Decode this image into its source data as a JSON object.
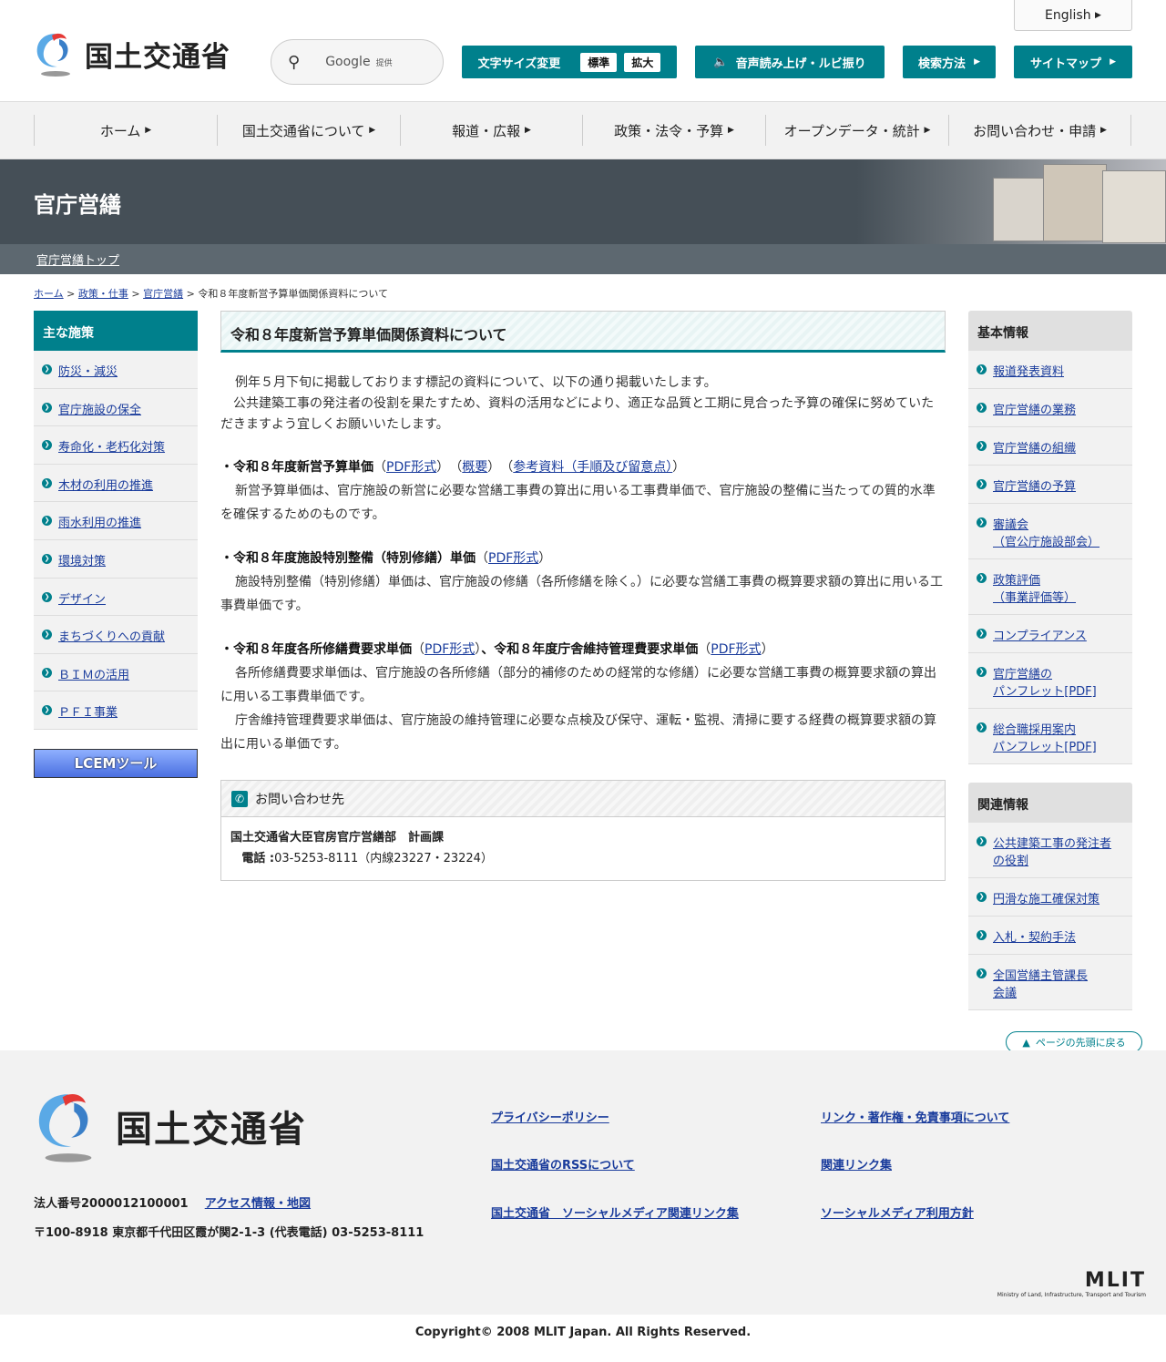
{
  "header": {
    "logo_text": "国土交通省",
    "search_label": "Google",
    "search_sub": "提供",
    "english": "English",
    "font_size_label": "文字サイズ変更",
    "font_standard": "標準",
    "font_large": "拡大",
    "voice_label": "音声読み上げ・ルビ振り",
    "search_method": "検索方法",
    "sitemap": "サイトマップ"
  },
  "gnav": [
    "ホーム",
    "国土交通省について",
    "報道・広報",
    "政策・法令・予算",
    "オープンデータ・統計",
    "お問い合わせ・申請"
  ],
  "banner": {
    "title": "官庁営繕",
    "sub_link": "官庁営繕トップ"
  },
  "breadcrumb": {
    "home": "ホーム",
    "policy": "政策・仕事",
    "eizen": "官庁営繕",
    "current": "令和８年度新営予算単価関係資料について"
  },
  "left_sidebar": {
    "title": "主な施策",
    "items": [
      "防災・減災",
      "官庁施設の保全",
      "寿命化・老朽化対策",
      "木材の利用の推進",
      "雨水利用の推進",
      "環境対策",
      "デザイン",
      "まちづくりへの貢献",
      "ＢＩＭの活用",
      "ＰＦＩ事業"
    ],
    "lcem": "LCEMツール"
  },
  "main": {
    "title": "令和８年度新営予算単価関係資料について",
    "intro1": "例年５月下旬に掲載しております標記の資料について、以下の通り掲載いたします。",
    "intro2": "公共建築工事の発注者の役割を果たすため、資料の活用などにより、適正な品質と工期に見合った予算の確保に努めていただきますよう宜しくお願いいたします。",
    "s1_title": "・令和８年度新営予算単価",
    "s1_pdf": "PDF形式",
    "s1_summary": "概要",
    "s1_ref": "参考資料（手順及び留意点）",
    "s1_text": "新営予算単価は、官庁施設の新営に必要な営繕工事費の算出に用いる工事費単価で、官庁施設の整備に当たっての質的水準を確保するためのものです。",
    "s2_title": "・令和８年度施設特別整備（特別修繕）単価",
    "s2_pdf": "PDF形式",
    "s2_text": "施設特別整備（特別修繕）単価は、官庁施設の修繕（各所修繕を除く。）に必要な営繕工事費の概算要求額の算出に用いる工事費単価です。",
    "s3_title_a": "・令和８年度各所修繕費要求単価",
    "s3_pdf_a": "PDF形式",
    "s3_title_b": "、令和８年度庁舎維持管理費要求単価",
    "s3_pdf_b": "PDF形式",
    "s3_text1": "各所修繕費要求単価は、官庁施設の各所修繕（部分的補修のための経常的な修繕）に必要な営繕工事費の概算要求額の算出に用いる工事費単価です。",
    "s3_text2": "庁舎維持管理費要求単価は、官庁施設の維持管理に必要な点検及び保守、運転・監視、清掃に要する経費の概算要求額の算出に用いる単価です。",
    "contact_title": "お問い合わせ先",
    "contact_org": "国土交通省大臣官房官庁営繕部　計画課",
    "contact_tel_label": "電話 :",
    "contact_tel": "03-5253-8111（内線23227・23224）"
  },
  "right_sidebar": {
    "basic_title": "基本情報",
    "basic_items": [
      [
        "報道発表資料"
      ],
      [
        "官庁営繕の業務"
      ],
      [
        "官庁営繕の組織"
      ],
      [
        "官庁営繕の予算"
      ],
      [
        "審議会",
        "（官公庁施設部会）"
      ],
      [
        "政策評価",
        "（事業評価等）"
      ],
      [
        "コンプライアンス"
      ],
      [
        "官庁営繕の",
        "パンフレット[PDF]"
      ],
      [
        "総合職採用案内",
        "パンフレット[PDF]"
      ]
    ],
    "related_title": "関連情報",
    "related_items": [
      [
        "公共建築工事の発注者",
        "の役割"
      ],
      [
        "円滑な施工確保対策"
      ],
      [
        "入札・契約手法"
      ],
      [
        "全国営繕主管課長",
        "会議"
      ]
    ]
  },
  "pagetop": "ページの先頭に戻る",
  "footer": {
    "logo_text": "国土交通省",
    "corp_no": "法人番号2000012100001",
    "access": "アクセス情報・地図",
    "address": "〒100-8918 東京都千代田区霞が関2-1-3 (代表電話) 03-5253-8111",
    "links": [
      "プライバシーポリシー",
      "リンク・著作権・免責事項について",
      "国土交通省のRSSについて",
      "関連リンク集",
      "国土交通省　ソーシャルメディア関連リンク集",
      "ソーシャルメディア利用方針"
    ],
    "mlit": "MLIT",
    "mlit_sub": "Ministry of Land, Infrastructure, Transport and Tourism",
    "copyright": "Copyright© 2008 MLIT Japan. All Rights Reserved."
  },
  "colors": {
    "accent": "#00808c",
    "banner": "#454f57",
    "link": "#1a3c9c"
  }
}
